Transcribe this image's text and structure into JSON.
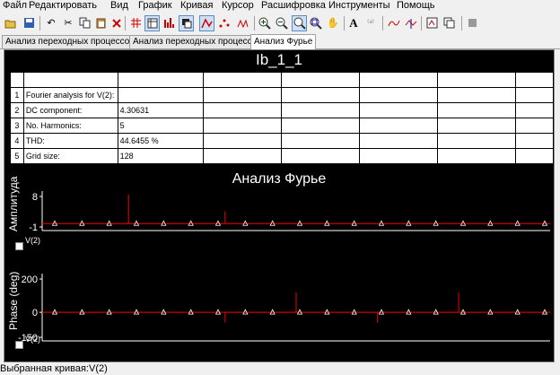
{
  "menu": [
    "Файл",
    "Редактировать",
    "Вид",
    "График",
    "Кривая",
    "Курсор",
    "Расшифровка",
    "Инструменты",
    "Помощь"
  ],
  "toolbar_icons": [
    "open-icon",
    "save-icon",
    "undo-icon",
    "cut-icon",
    "copy-icon",
    "paste-icon",
    "delete-icon",
    "grid-icon",
    "table-icon",
    "bar-chart-icon",
    "window-icon",
    "line-icon",
    "points-icon",
    "peaks-icon",
    "zoom-in-icon",
    "zoom-out-icon",
    "zoom-area-icon",
    "zoom-fit-icon",
    "pan-hand-icon",
    "text-icon",
    "label-icon",
    "curve-fit-icon",
    "cursor-icon",
    "export-icon",
    "copy-plot-icon",
    "stop-icon"
  ],
  "tabs": [
    "Анализ переходных процессов",
    "Анализ переходных процессов",
    "Анализ Фурье"
  ],
  "plot": {
    "title": "Ib_1_1",
    "table": {
      "rows": [
        {
          "n": "1",
          "label": "Fourier analysis for V(2):",
          "value": ""
        },
        {
          "n": "2",
          "label": "DC component:",
          "value": "4.30631"
        },
        {
          "n": "3",
          "label": "No. Harmonics:",
          "value": "5"
        },
        {
          "n": "4",
          "label": "THD:",
          "value": "44.6455 %"
        },
        {
          "n": "5",
          "label": "Grid size:",
          "value": "128"
        }
      ]
    },
    "chart_title": "Анализ Фурье",
    "legend1": "V(2)",
    "legend2": "V(2)"
  },
  "status": "Выбранная кривая:V(2)",
  "chart_data": [
    {
      "type": "bar",
      "ylabel": "Амплитуда",
      "yticks": [
        "8",
        "-1"
      ],
      "ylim": [
        -1,
        8
      ],
      "series": [
        {
          "name": "V(2)",
          "color": "#cc0000",
          "markers": 19,
          "spikes": [
            {
              "pos": 0.17,
              "value": 8.6
            },
            {
              "pos": 0.36,
              "value": 3.7
            }
          ]
        }
      ]
    },
    {
      "type": "bar",
      "ylabel": "Phase (deg)",
      "yticks": [
        "200",
        "0",
        "-150"
      ],
      "ylim": [
        -150,
        200
      ],
      "series": [
        {
          "name": "V(2)",
          "color": "#cc0000",
          "markers": 19,
          "spikes": [
            {
              "pos": 0.36,
              "value": -60
            },
            {
              "pos": 0.5,
              "value": 120
            },
            {
              "pos": 0.66,
              "value": -60
            },
            {
              "pos": 0.82,
              "value": 120
            }
          ]
        }
      ]
    }
  ]
}
